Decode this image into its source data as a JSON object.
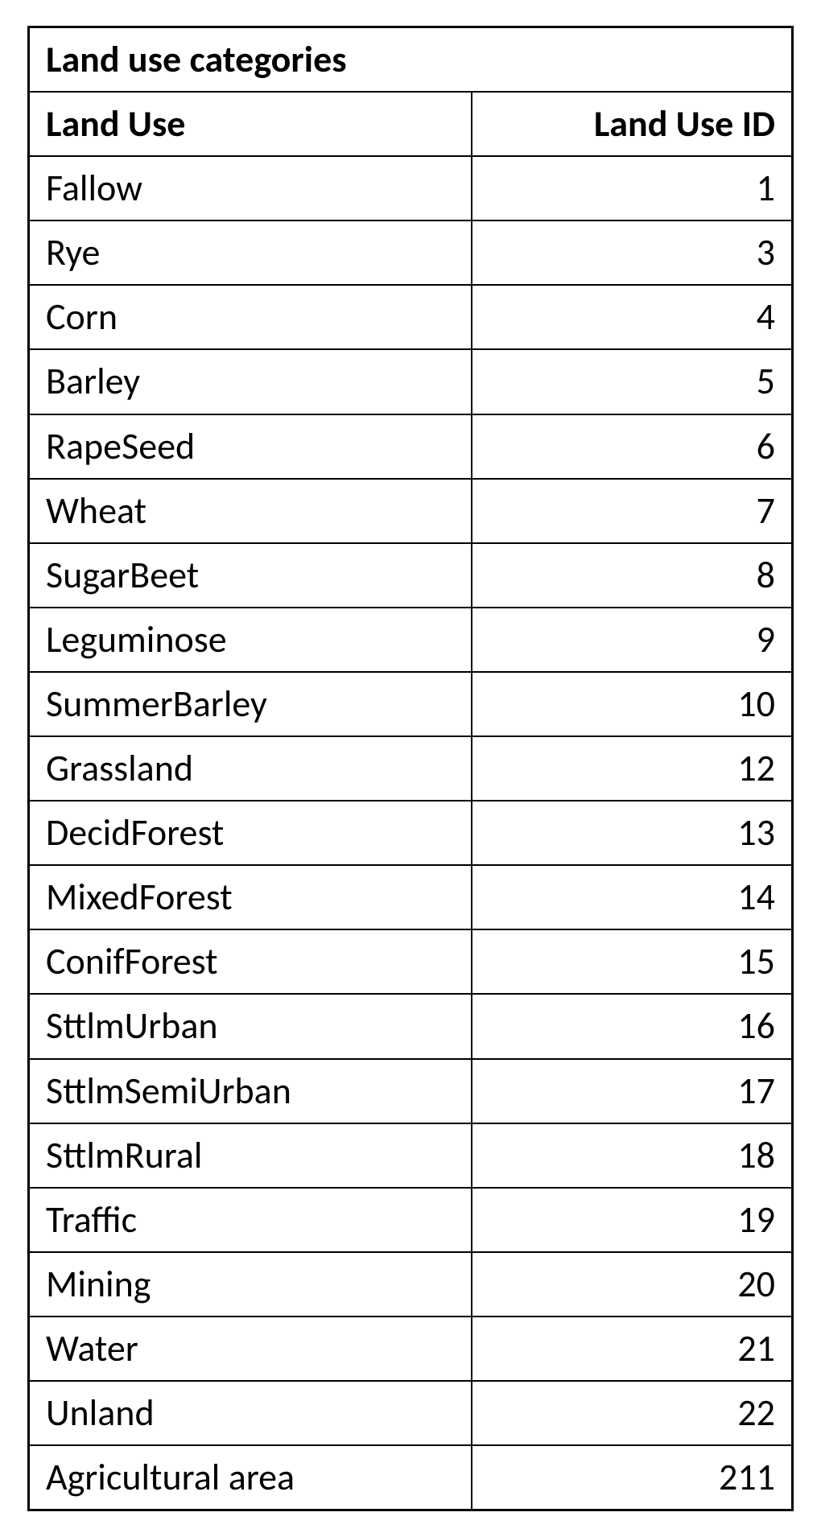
{
  "chart_data": {
    "type": "table",
    "title": "Land use categories",
    "columns": [
      "Land Use",
      "Land Use ID"
    ],
    "rows": [
      {
        "land_use": "Fallow",
        "id": 1
      },
      {
        "land_use": "Rye",
        "id": 3
      },
      {
        "land_use": "Corn",
        "id": 4
      },
      {
        "land_use": "Barley",
        "id": 5
      },
      {
        "land_use": "RapeSeed",
        "id": 6
      },
      {
        "land_use": "Wheat",
        "id": 7
      },
      {
        "land_use": "SugarBeet",
        "id": 8
      },
      {
        "land_use": "Leguminose",
        "id": 9
      },
      {
        "land_use": "SummerBarley",
        "id": 10
      },
      {
        "land_use": "Grassland",
        "id": 12
      },
      {
        "land_use": "DecidForest",
        "id": 13
      },
      {
        "land_use": "MixedForest",
        "id": 14
      },
      {
        "land_use": "ConifForest",
        "id": 15
      },
      {
        "land_use": "SttlmUrban",
        "id": 16
      },
      {
        "land_use": "SttlmSemiUrban",
        "id": 17
      },
      {
        "land_use": "SttlmRural",
        "id": 18
      },
      {
        "land_use": "Traffic",
        "id": 19
      },
      {
        "land_use": "Mining",
        "id": 20
      },
      {
        "land_use": "Water",
        "id": 21
      },
      {
        "land_use": "Unland",
        "id": 22
      },
      {
        "land_use": "Agricultural area",
        "id": 211
      }
    ]
  }
}
